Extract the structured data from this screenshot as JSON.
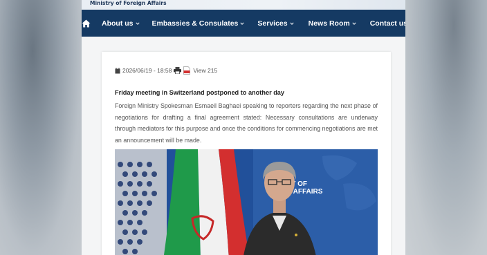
{
  "header": {
    "ministry_name": "Ministry of Foreign Affairs"
  },
  "nav": {
    "home_icon": "home-icon",
    "items": [
      {
        "label": "About us",
        "has_dropdown": true
      },
      {
        "label": "Embassies & Consulates",
        "has_dropdown": true
      },
      {
        "label": "Services",
        "has_dropdown": true
      },
      {
        "label": "News Room",
        "has_dropdown": true
      },
      {
        "label": "Contact us",
        "has_dropdown": false
      }
    ]
  },
  "article": {
    "date": "2026/06/19 - 18:58",
    "views": "View 215",
    "icons": [
      "calendar-icon",
      "print-icon",
      "pdf-icon"
    ],
    "headline": "Friday meeting in Switzerland postponed to another day",
    "body": "Foreign Ministry Spokesman Esmaeil Baghaei speaking to reporters regarding the next phase of negotiations for drafting a final agreement stated: Necessary consultations are underway through mediators for this purpose and once the conditions for commencing negotiations are met an announcement will be made.",
    "photo_backdrop_text": "RY OF\nN AFFAIRS"
  },
  "colors": {
    "navbar": "#153a63",
    "card": "#ffffff",
    "photo_backdrop": "#21509a"
  }
}
